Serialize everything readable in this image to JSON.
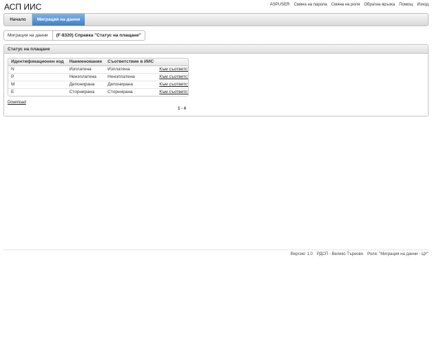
{
  "app": {
    "title": "АСП ИИС"
  },
  "top_links": [
    "ASPUSER",
    "Смяна на парола",
    "Смяна на роля",
    "Обратна връзка",
    "Помощ",
    "Изход"
  ],
  "nav": {
    "home": "Начало",
    "active": "Миграция на данни"
  },
  "breadcrumb": {
    "parent": "Миграция на данни",
    "current": "(F-8320) Справка \"Статус на плащане\""
  },
  "panel": {
    "title": "Статус на плащане",
    "columns": [
      "Идентификационен код",
      "Наименование",
      "Съответствие в ИИС",
      ""
    ],
    "rows": [
      {
        "code": "N",
        "name": "Изплатена",
        "match": "Изплатена",
        "action": "Към съответствие"
      },
      {
        "code": "P",
        "name": "Неизплатена",
        "match": "Неизплатена",
        "action": "Към съответствие"
      },
      {
        "code": "M",
        "name": "Депонирана",
        "match": "Депонирана",
        "action": "Към съответствие"
      },
      {
        "code": "E",
        "name": "Сторнирана",
        "match": "Сторнирана",
        "action": "Към съответствие"
      }
    ],
    "download": "Download",
    "pager": "1 - 4"
  },
  "footer": {
    "version": "Версия: 1.0",
    "office": "РДСП - Велико Търново",
    "role": "Роля: \"Миграция на данни - ЦУ\""
  }
}
